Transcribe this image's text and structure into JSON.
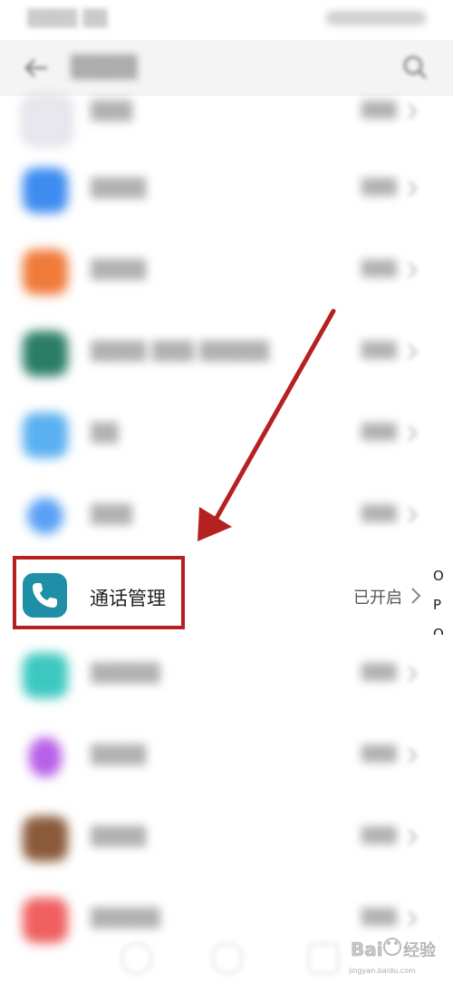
{
  "focused_item": {
    "name": "通话管理",
    "status": "已开启"
  },
  "index_letters": [
    "O",
    "P",
    "Q"
  ],
  "watermark": {
    "logo_text": "Bai 经验",
    "url": "jingyan.baidu.com"
  },
  "colors": {
    "highlight": "#b52121",
    "phone_icon_bg": "#1e8fa6"
  },
  "icons": [
    "back-arrow-icon",
    "search-icon",
    "phone-icon",
    "chevron-right-icon",
    "annotation-arrow"
  ]
}
